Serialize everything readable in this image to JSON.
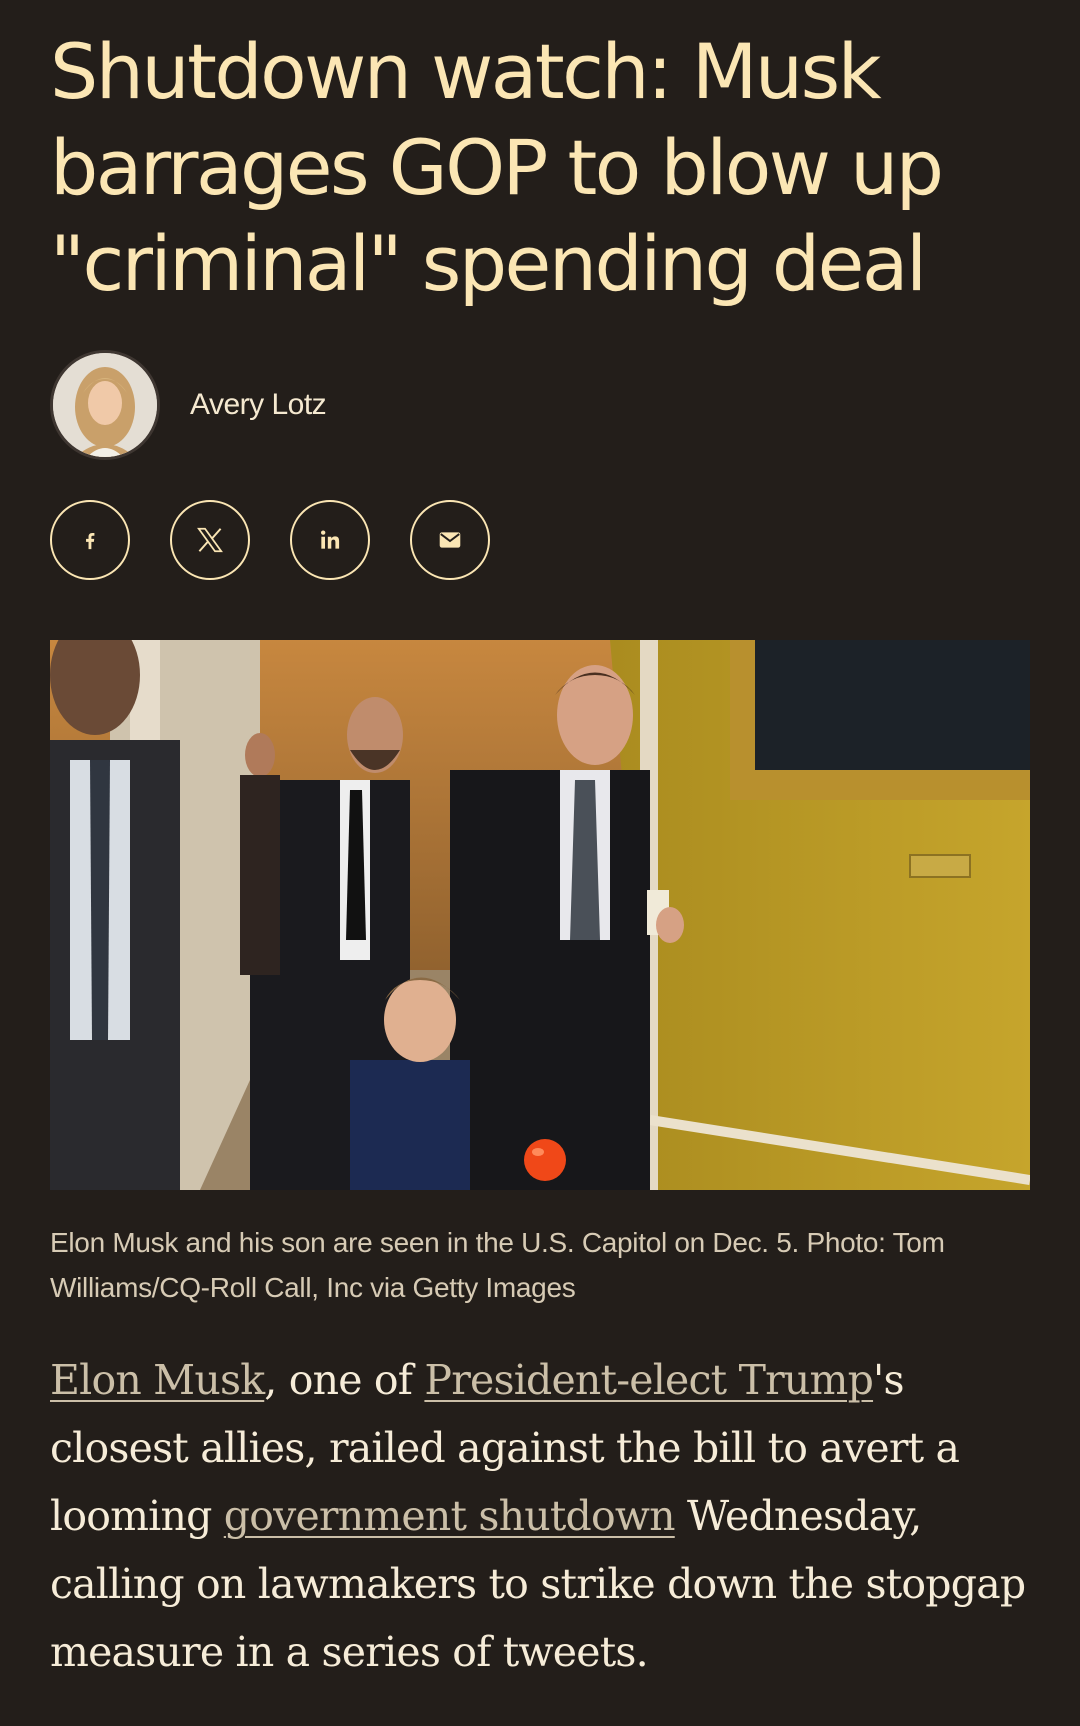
{
  "article": {
    "headline": "Shutdown watch: Musk barrages GOP to blow up \"criminal\" spending deal",
    "author": "Avery Lotz",
    "caption": "Elon Musk and his son are seen in the U.S. Capitol on Dec. 5. Photo: Tom Williams/CQ-Roll Call, Inc via Getty Images",
    "body": {
      "link1": "Elon Musk",
      "text1": ", one of ",
      "link2": "President-elect Trump",
      "text2": "'s closest allies, railed against the bill to avert a looming ",
      "link3": "government shutdown",
      "text3": " Wednesday, calling on lawmakers to strike down the stopgap measure in a series of tweets."
    }
  },
  "share": {
    "icons": [
      "facebook-icon",
      "x-icon",
      "linkedin-icon",
      "email-icon"
    ]
  },
  "colors": {
    "background": "#231e1a",
    "headline": "#fbe6b4",
    "link": "#cbbfa8"
  }
}
